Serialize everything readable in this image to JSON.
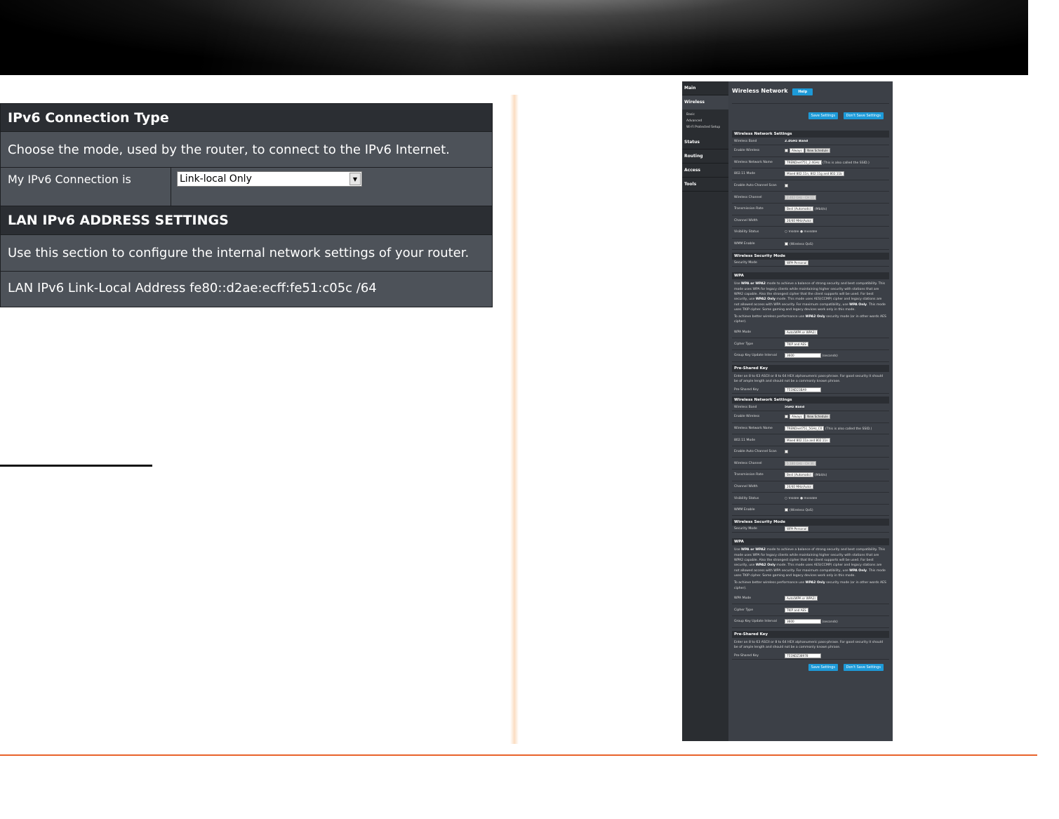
{
  "ipv6": {
    "connection_header": "IPv6 Connection Type",
    "connection_desc": "Choose the mode, used by the router, to connect to the IPv6 Internet.",
    "connection_label": "My IPv6 Connection is",
    "connection_value": "Link-local Only",
    "lan_header": "LAN IPv6 ADDRESS SETTINGS",
    "lan_desc": "Use this section to configure the internal network settings of your router.",
    "lan_address": "LAN IPv6 Link-Local Address fe80::d2ae:ecff:fe51:c05c /64"
  },
  "router": {
    "nav": {
      "main": "Main",
      "wireless": "Wireless",
      "basic": "Basic",
      "advanced": "Advanced",
      "wps": "Wi-Fi Protected Setup",
      "status": "Status",
      "routing": "Routing",
      "access": "Access",
      "tools": "Tools"
    },
    "title": "Wireless Network",
    "help": "Help",
    "save": "Save Settings",
    "dont_save": "Don't Save Settings",
    "wns_header": "Wireless Network Settings",
    "labels": {
      "band": "Wireless Band",
      "enable": "Enable Wireless",
      "name": "Wireless Network Name",
      "mode": "802.11 Mode",
      "auto_scan": "Enable Auto Channel Scan",
      "channel": "Wireless Channel",
      "rate": "Transmission Rate",
      "width": "Channel Width",
      "visibility": "Visibility Status",
      "wmm": "WMM Enable",
      "security_mode": "Security Mode",
      "wpa_mode": "WPA Mode",
      "cipher": "Cipher Type",
      "gkui": "Group Key Update Interval",
      "psk": "Pre-Shared Key"
    },
    "common": {
      "always": "Always",
      "new_schedule": "New Schedule",
      "ssid_note": "(This is also called the SSID.)",
      "rate": "Best (Automatic)",
      "mbits": "(Mbit/s)",
      "width": "20/40 MHz(Auto)",
      "visible": "Visible",
      "invisible": "Invisible",
      "wmm": "(Wireless QoS)",
      "sec_header": "Wireless Security Mode",
      "sec_mode": "WPA-Personal",
      "wpa_header": "WPA",
      "wpa_p1_a": "Use ",
      "wpa_p1_b": "WPA or WPA2",
      "wpa_p1_c": " mode to achieve a balance of strong security and best compatibility. This mode uses WPA for legacy clients while maintaining higher security with stations that are WPA2 capable. Also the strongest cipher that the client supports will be used. For best security, use ",
      "wpa_p1_d": "WPA2 Only",
      "wpa_p1_e": " mode. This mode uses AES(CCMP) cipher and legacy stations are not allowed access with WPA security. For maximum compatibility, use ",
      "wpa_p1_f": "WPA Only",
      "wpa_p1_g": ". This mode uses TKIP cipher. Some gaming and legacy devices work only in this mode.",
      "wpa_p2_a": "To achieve better wireless performance use ",
      "wpa_p2_b": "WPA2 Only",
      "wpa_p2_c": " security mode (or in other words AES cipher).",
      "wpa_mode": "Auto(WPA or WPA2)",
      "cipher": "TKIP and AES",
      "gkui": "3600",
      "seconds": "(seconds)",
      "psk_header": "Pre-Shared Key",
      "psk_desc": "Enter an 8 to 63 ASCII or 8 to 64 HEX alphanumeric pass-phrase. For good security it should be of ample length and should not be a commonly known phrase."
    },
    "band24": {
      "band": "2.4GHz Band",
      "ssid": "TRENDnet751_2.4GHz",
      "mode": "Mixed 802.11n, 802.11g and 802.11b",
      "channel": "2.462 GHz - CH 11",
      "psk": "751ND23BA9"
    },
    "band5": {
      "band": "5GHz Band",
      "ssid": "TRENDnet751_5GHz_C0",
      "mode": "Mixed 802.11a and 802.11n",
      "channel": "5.180 GHz - CH 36",
      "psk": "751NDZ38978"
    }
  }
}
